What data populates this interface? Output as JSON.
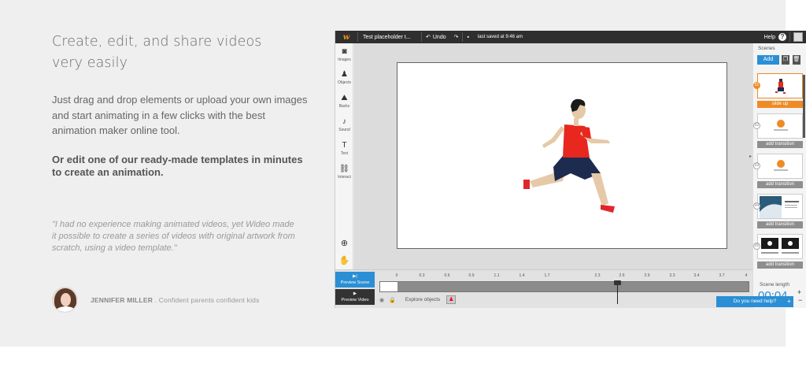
{
  "marketing": {
    "headline_line1": "Create, edit, and share videos",
    "headline_line2": "very easily",
    "intro": "Just drag and drop elements or upload your own images and start animating in a few clicks with the best animation maker online tool.",
    "intro_bold": "Or edit one of our ready-made templates in minutes to create an animation.",
    "quote": "\"I had no experience making animated videos, yet Wideo made it possible to create a series of videos with original artwork from scratch, using a video template.\"",
    "testimonial_name": "JENNIFER MILLER",
    "testimonial_role": ". Confident parents confident kids"
  },
  "editor": {
    "topbar": {
      "project_title": "Test placeholder t...",
      "undo_label": "Undo",
      "saved_text": "last saved at 9:46 am",
      "help_label": "Help"
    },
    "tools": [
      {
        "label": "Images",
        "icon": "camera-icon"
      },
      {
        "label": "Objects",
        "icon": "person-icon"
      },
      {
        "label": "Backs",
        "icon": "landscape-icon"
      },
      {
        "label": "Sound",
        "icon": "music-note-icon"
      },
      {
        "label": "Text",
        "icon": "text-icon"
      },
      {
        "label": "Interact",
        "icon": "link-icon"
      }
    ],
    "scenes_panel": {
      "title": "Scenes",
      "add_label": "Add",
      "scenes": [
        {
          "num": "01",
          "transition": "slide up",
          "active": true
        },
        {
          "num": "02",
          "transition": "add transition",
          "active": false
        },
        {
          "num": "03",
          "transition": "add transition",
          "active": false
        },
        {
          "num": "04",
          "transition": "add transition",
          "active": false
        },
        {
          "num": "05",
          "transition": "add transition",
          "active": false
        }
      ],
      "scene_length_label": "Scene length",
      "scene_length_value": "00:04",
      "help_tab": "Do you need help?"
    },
    "timeline": {
      "preview_scene": "Preview Scene",
      "preview_video": "Preview Video",
      "ticks": [
        "0",
        "0.3",
        "0.6",
        "0.9",
        "1.1",
        "1.4",
        "1.7",
        "",
        "2.3",
        "2.6",
        "2.9",
        "3.3",
        "3.4",
        "3.7",
        "4"
      ],
      "explore_label": "Explore objects"
    },
    "colors": {
      "accent": "#2a8fd4",
      "orange": "#f08a24",
      "topbar": "#2f2f2f"
    }
  }
}
